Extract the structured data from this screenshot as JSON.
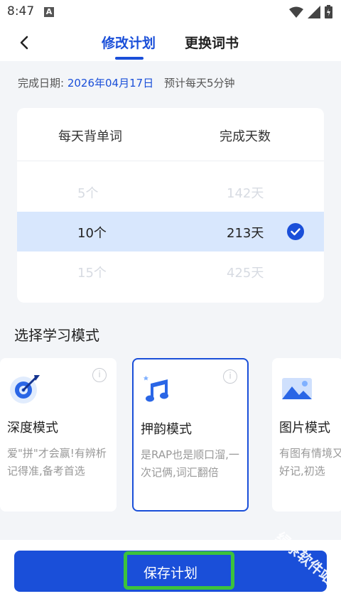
{
  "status_bar": {
    "time": "8:47",
    "notif_icon": "A"
  },
  "header": {
    "tabs": [
      "修改计划",
      "更换词书"
    ],
    "active_tab": 0
  },
  "info": {
    "label": "完成日期:",
    "date": "2026年04月17日",
    "estimate": "预计每天5分钟"
  },
  "picker": {
    "headers": [
      "每天背单词",
      "完成天数"
    ],
    "rows": [
      {
        "words": "5个",
        "days": "142天"
      },
      {
        "words": "10个",
        "days": "213天",
        "selected": true
      },
      {
        "words": "15个",
        "days": "425天"
      }
    ]
  },
  "modes": {
    "title": "选择学习模式",
    "items": [
      {
        "name": "深度模式",
        "desc": "爱\"拼\"才会赢!有辨析记得准,备考首选",
        "icon": "target-icon"
      },
      {
        "name": "押韵模式",
        "desc": "是RAP也是顺口溜,一次记俩,词汇翻倍",
        "icon": "music-note-icon",
        "selected": true
      },
      {
        "name": "图片模式",
        "desc": "有图有情境又好记,初选",
        "icon": "picture-icon"
      }
    ]
  },
  "save_button": {
    "label": "保存计划"
  },
  "watermark": "绿茶软件站",
  "colors": {
    "primary": "#1a4fd9",
    "highlight_row": "#d8e7fd",
    "green_outline": "#3cc23c"
  }
}
